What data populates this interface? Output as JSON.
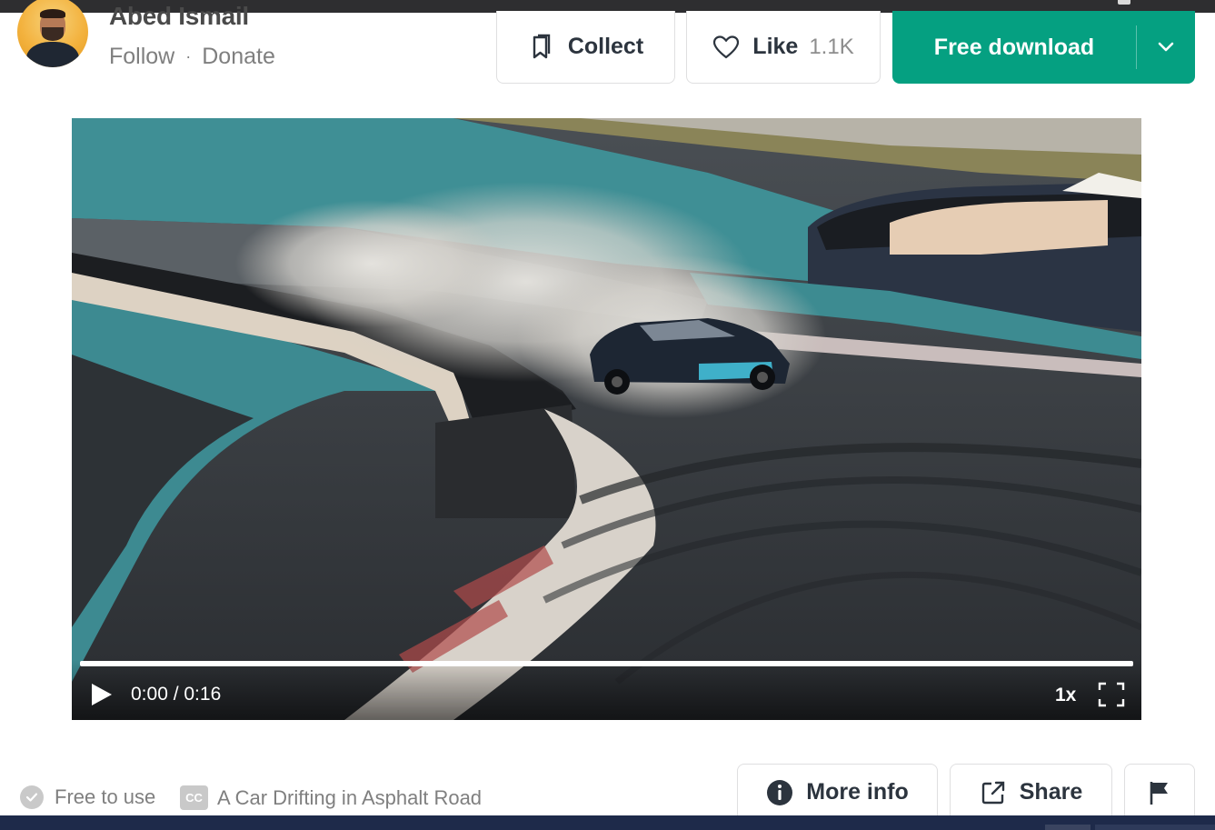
{
  "author": {
    "name": "Abed Ismail",
    "follow": "Follow",
    "separator": "·",
    "donate": "Donate"
  },
  "actions": {
    "collect": "Collect",
    "like": "Like",
    "like_count": "1.1K",
    "download": "Free download"
  },
  "player": {
    "current_time": "0:00",
    "duration": "0:16",
    "time_display": "0:00 / 0:16",
    "speed": "1x",
    "progress": 0
  },
  "footer": {
    "license": "Free to use",
    "title": "A Car Drifting in Asphalt Road",
    "more_info": "More info",
    "share": "Share"
  },
  "colors": {
    "accent": "#05a081",
    "text": "#2c343e",
    "muted": "#7f7f7f"
  },
  "icons": [
    "bookmark-icon",
    "heart-icon",
    "chevron-down-icon",
    "play-icon",
    "fullscreen-icon",
    "check-circle-icon",
    "closed-caption-icon",
    "info-icon",
    "share-icon",
    "flag-icon"
  ]
}
